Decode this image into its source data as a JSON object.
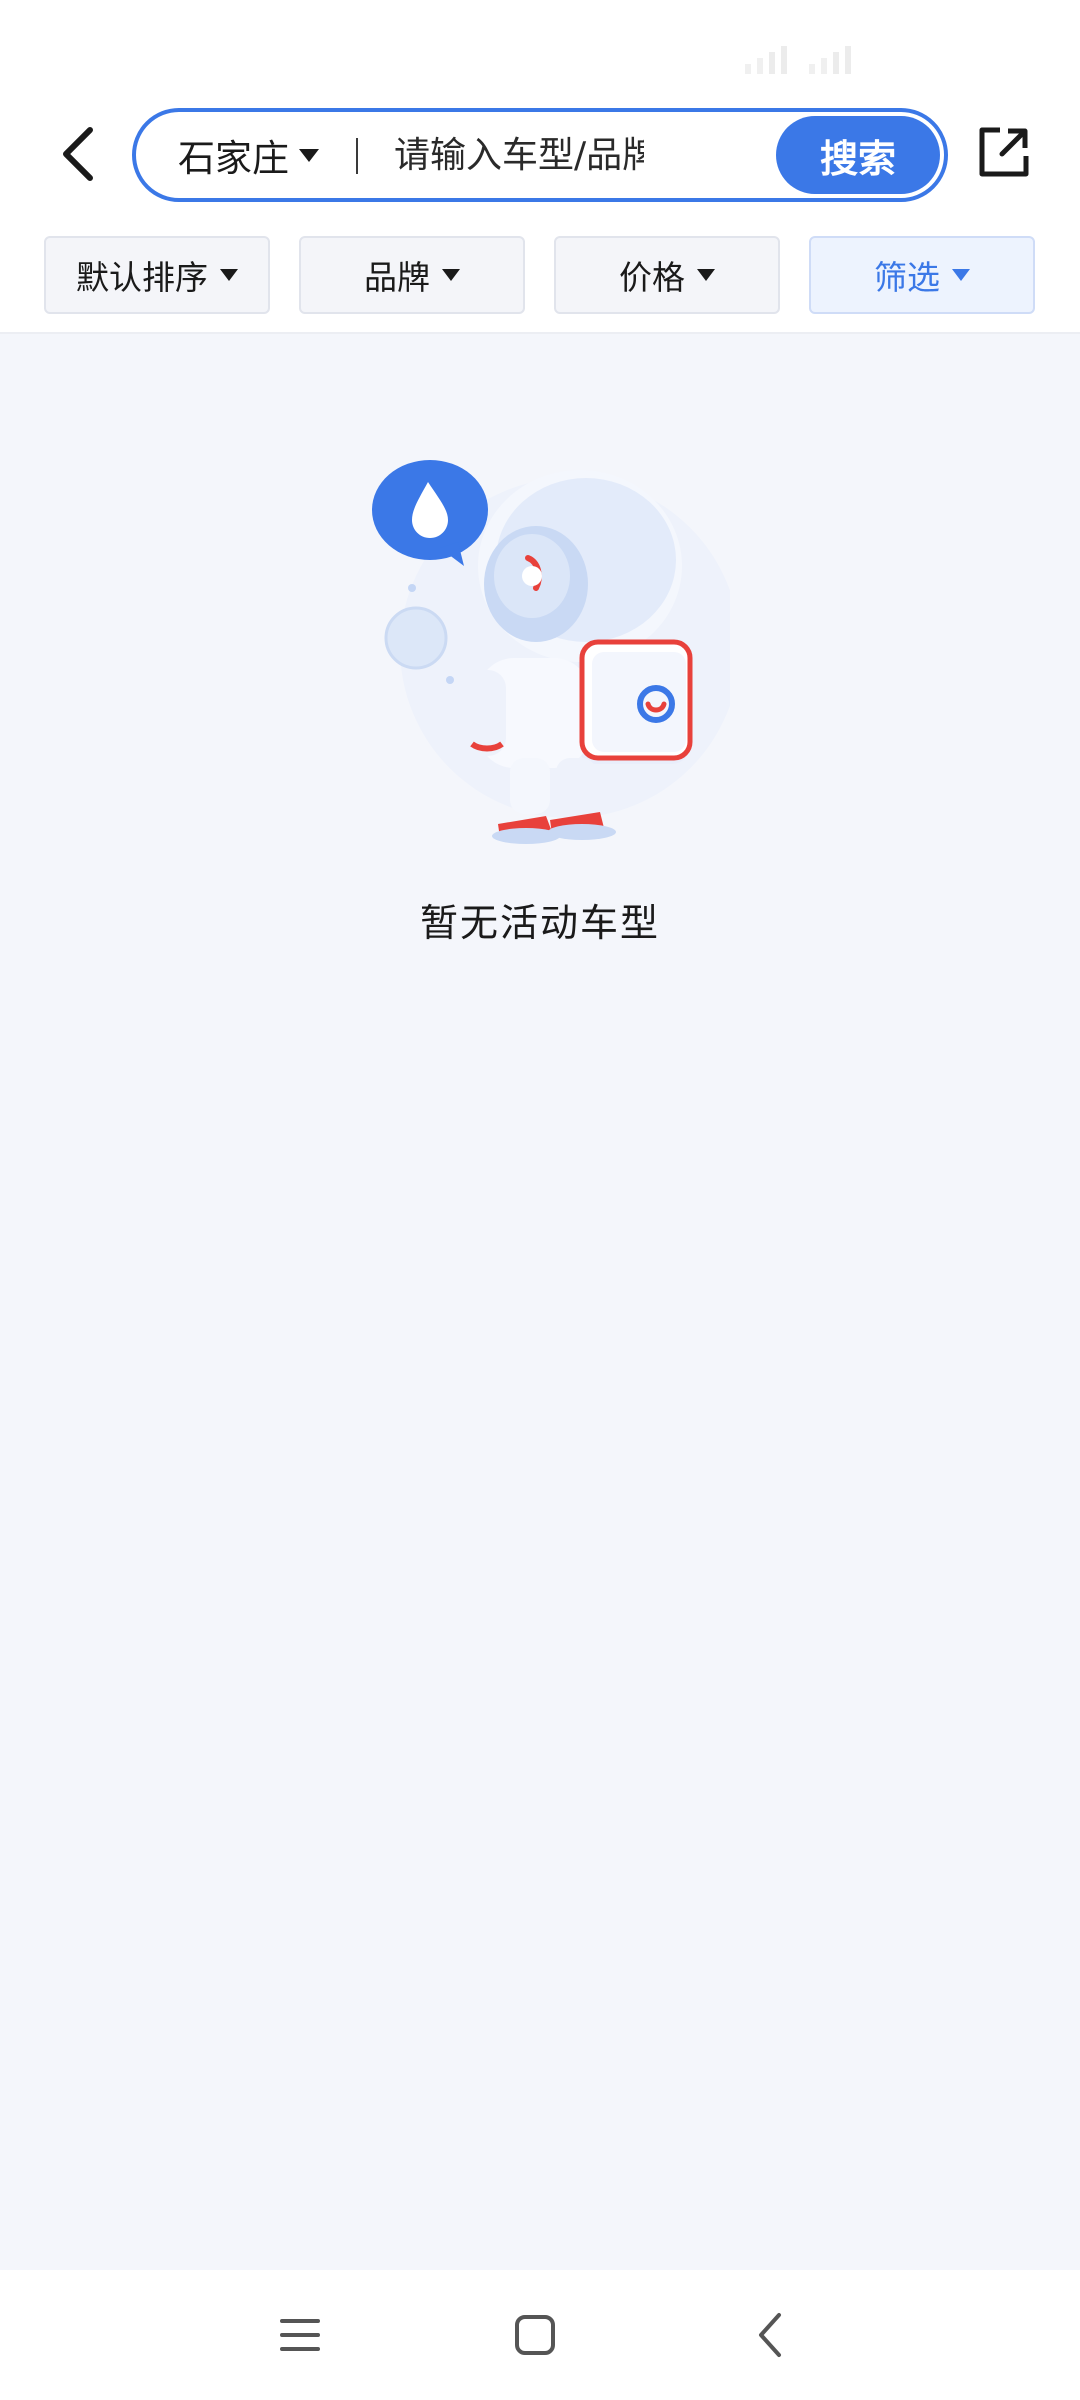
{
  "header": {
    "back_icon": "chevron-left-icon",
    "share_icon": "share-external-icon"
  },
  "search": {
    "city": "石家庄",
    "placeholder": "请输入车型/品牌名",
    "button_label": "搜索"
  },
  "filters": [
    {
      "label": "默认排序",
      "active": false
    },
    {
      "label": "品牌",
      "active": false
    },
    {
      "label": "价格",
      "active": false
    },
    {
      "label": "筛选",
      "active": true
    }
  ],
  "empty_state": {
    "message": "暂无活动车型",
    "illustration": "astronaut-illustration"
  },
  "system_nav": {
    "icons": [
      "menu-icon",
      "home-square-icon",
      "back-chevron-icon"
    ]
  },
  "colors": {
    "accent": "#3b78e7",
    "background": "#f4f6fb",
    "brand_red": "#e8413b"
  }
}
